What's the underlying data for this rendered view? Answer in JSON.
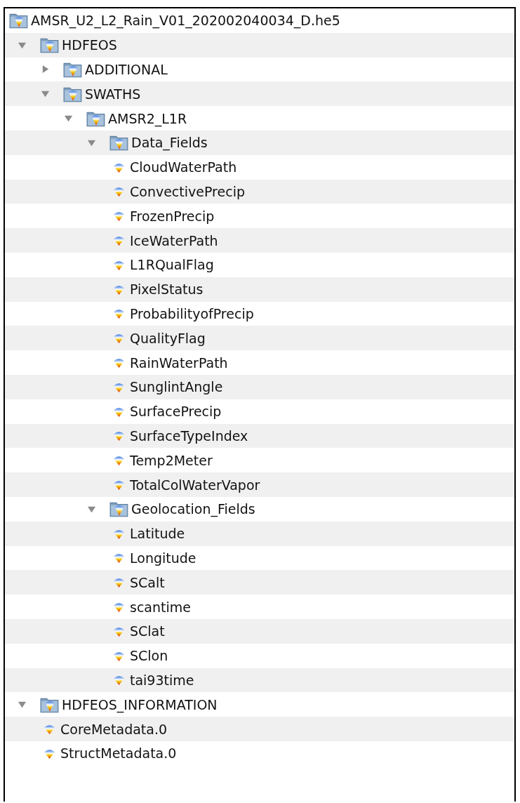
{
  "tree": {
    "label": "AMSR_U2_L2_Rain_V01_202002040034_D.he5",
    "kind": "file",
    "children": [
      {
        "label": "HDFEOS",
        "kind": "group",
        "expanded": true,
        "children": [
          {
            "label": "ADDITIONAL",
            "kind": "group",
            "expanded": false
          },
          {
            "label": "SWATHS",
            "kind": "group",
            "expanded": true,
            "children": [
              {
                "label": "AMSR2_L1R",
                "kind": "group",
                "expanded": true,
                "children": [
                  {
                    "label": "Data_Fields",
                    "kind": "group",
                    "expanded": true,
                    "children": [
                      {
                        "label": "CloudWaterPath",
                        "kind": "dataset"
                      },
                      {
                        "label": "ConvectivePrecip",
                        "kind": "dataset"
                      },
                      {
                        "label": "FrozenPrecip",
                        "kind": "dataset"
                      },
                      {
                        "label": "IceWaterPath",
                        "kind": "dataset"
                      },
                      {
                        "label": "L1RQualFlag",
                        "kind": "dataset"
                      },
                      {
                        "label": "PixelStatus",
                        "kind": "dataset"
                      },
                      {
                        "label": "ProbabilityofPrecip",
                        "kind": "dataset"
                      },
                      {
                        "label": "QualityFlag",
                        "kind": "dataset"
                      },
                      {
                        "label": "RainWaterPath",
                        "kind": "dataset"
                      },
                      {
                        "label": "SunglintAngle",
                        "kind": "dataset"
                      },
                      {
                        "label": "SurfacePrecip",
                        "kind": "dataset"
                      },
                      {
                        "label": "SurfaceTypeIndex",
                        "kind": "dataset"
                      },
                      {
                        "label": "Temp2Meter",
                        "kind": "dataset"
                      },
                      {
                        "label": "TotalColWaterVapor",
                        "kind": "dataset"
                      }
                    ]
                  },
                  {
                    "label": "Geolocation_Fields",
                    "kind": "group",
                    "expanded": true,
                    "children": [
                      {
                        "label": "Latitude",
                        "kind": "dataset"
                      },
                      {
                        "label": "Longitude",
                        "kind": "dataset"
                      },
                      {
                        "label": "SCalt",
                        "kind": "dataset"
                      },
                      {
                        "label": "scantime",
                        "kind": "dataset"
                      },
                      {
                        "label": "SClat",
                        "kind": "dataset"
                      },
                      {
                        "label": "SClon",
                        "kind": "dataset"
                      },
                      {
                        "label": "tai93time",
                        "kind": "dataset"
                      }
                    ]
                  }
                ]
              }
            ]
          }
        ]
      },
      {
        "label": "HDFEOS_INFORMATION",
        "kind": "group",
        "expanded": true,
        "children": [
          {
            "label": "CoreMetadata.0",
            "kind": "dataset"
          },
          {
            "label": "StructMetadata.0",
            "kind": "dataset"
          }
        ]
      }
    ]
  }
}
